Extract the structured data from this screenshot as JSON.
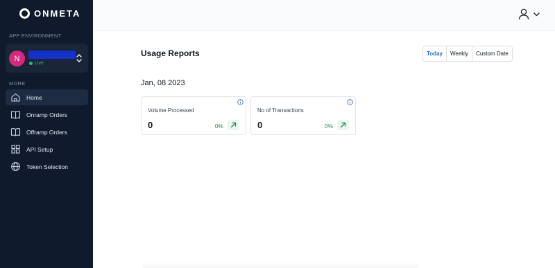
{
  "brand": {
    "name": "ONMETA"
  },
  "sidebar": {
    "env_label": "APP ENVIRONMENT",
    "env": {
      "avatar_letter": "N",
      "status": "Live"
    },
    "more_label": "MORE",
    "items": [
      {
        "label": "Home",
        "icon": "home-icon",
        "active": true
      },
      {
        "label": "Onramp Orders",
        "icon": "book-icon"
      },
      {
        "label": "Offramp Orders",
        "icon": "book-icon"
      },
      {
        "label": "API Setup",
        "icon": "grid-icon"
      },
      {
        "label": "Token Selection",
        "icon": "globe-icon"
      }
    ]
  },
  "main": {
    "title": "Usage Reports",
    "range": {
      "options": [
        "Today",
        "Weekly",
        "Custom Date"
      ],
      "selected": "Today"
    },
    "date": "Jan, 08 2023",
    "cards": [
      {
        "title": "Volume Processed",
        "value": "0",
        "change": "0%"
      },
      {
        "title": "No of Transactions",
        "value": "0",
        "change": "0%"
      }
    ]
  },
  "colors": {
    "sidebar_bg": "#0f1b2d",
    "accent": "#1d6fd1",
    "live": "#29c27a",
    "positive": "#1f8f4e",
    "avatar": "#d6287c"
  }
}
